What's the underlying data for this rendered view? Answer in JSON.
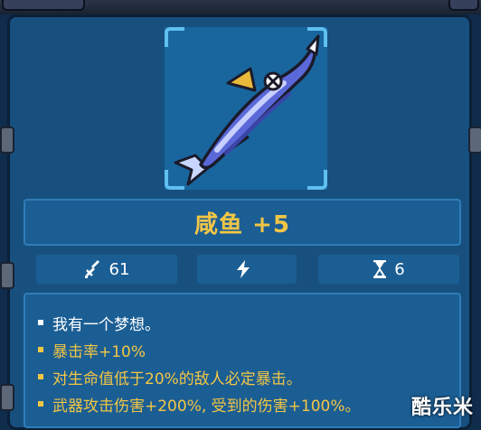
{
  "item": {
    "name": "咸鱼 +5",
    "icon": "salted-fish-icon"
  },
  "stats": {
    "damage": {
      "icon": "sword-icon",
      "value": "61"
    },
    "energy": {
      "icon": "lightning-icon",
      "value": ""
    },
    "cooldown": {
      "icon": "hourglass-icon",
      "value": "6"
    }
  },
  "description": [
    {
      "text": "我有一个梦想。",
      "color": "#ffffff"
    },
    {
      "text": "暴击率+10%",
      "color": "#f2c645"
    },
    {
      "text": "对生命值低于20%的敌人必定暴击。",
      "color": "#f2c645"
    },
    {
      "text": "武器攻击伤害+200%, 受到的伤害+100%。",
      "color": "#f2c645"
    }
  ],
  "watermark": "酷乐米"
}
